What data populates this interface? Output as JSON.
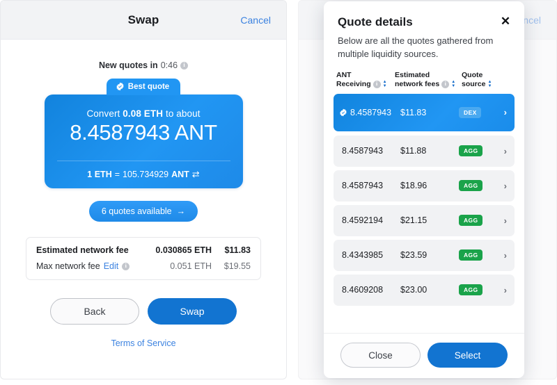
{
  "swap_panel": {
    "header": {
      "title": "Swap",
      "cancel_label": "Cancel"
    },
    "new_quotes": {
      "label": "New quotes in",
      "timer": "0:46",
      "info_icon": "info-icon"
    },
    "best_quote": {
      "tab_label": "Best quote",
      "badge_icon": "verified-check-icon",
      "convert_prefix": "Convert",
      "convert_amount": "0.08 ETH",
      "convert_suffix": "to about",
      "receive_amount": "8.4587943",
      "receive_symbol": "ANT",
      "rate_from": "1 ETH",
      "rate_eq": "=",
      "rate_to_value": "105.734929",
      "rate_to_symbol": "ANT",
      "swap_icon": "swap-arrows-icon"
    },
    "quotes_button": {
      "label": "6 quotes available",
      "arrow_icon": "arrow-right-icon"
    },
    "fees": {
      "estimated_label": "Estimated network fee",
      "estimated_eth": "0.030865 ETH",
      "estimated_usd": "$11.83",
      "max_label": "Max network fee",
      "max_edit_label": "Edit",
      "max_info_icon": "info-icon",
      "max_eth": "0.051 ETH",
      "max_usd": "$19.55"
    },
    "actions": {
      "back_label": "Back",
      "swap_label": "Swap"
    },
    "terms_label": "Terms of Service"
  },
  "background_panel": {
    "header": {
      "title": "Swap",
      "cancel_label": "Cancel"
    }
  },
  "modal": {
    "title": "Quote details",
    "close_icon": "close-icon",
    "subtitle": "Below are all the quotes gathered from multiple liquidity sources.",
    "columns": [
      {
        "line1": "ANT",
        "line2": "Receiving",
        "info_icon": "info-icon",
        "sort_icon": "sort-icon"
      },
      {
        "line1": "Estimated",
        "line2": "network fees",
        "info_icon": "info-icon",
        "sort_icon": "sort-icon"
      },
      {
        "line1": "Quote",
        "line2": "source",
        "info_icon": "",
        "sort_icon": "sort-icon"
      }
    ],
    "rows": [
      {
        "amount": "8.4587943",
        "fee": "$11.83",
        "source": "DEX",
        "source_type": "dex",
        "selected": true,
        "badge_icon": "verified-check-icon",
        "chevron_icon": "chevron-right-icon"
      },
      {
        "amount": "8.4587943",
        "fee": "$11.88",
        "source": "AGG",
        "source_type": "agg",
        "selected": false,
        "badge_icon": "",
        "chevron_icon": "chevron-right-icon"
      },
      {
        "amount": "8.4587943",
        "fee": "$18.96",
        "source": "AGG",
        "source_type": "agg",
        "selected": false,
        "badge_icon": "",
        "chevron_icon": "chevron-right-icon"
      },
      {
        "amount": "8.4592194",
        "fee": "$21.15",
        "source": "AGG",
        "source_type": "agg",
        "selected": false,
        "badge_icon": "",
        "chevron_icon": "chevron-right-icon"
      },
      {
        "amount": "8.4343985",
        "fee": "$23.59",
        "source": "AGG",
        "source_type": "agg",
        "selected": false,
        "badge_icon": "",
        "chevron_icon": "chevron-right-icon"
      },
      {
        "amount": "8.4609208",
        "fee": "$23.00",
        "source": "AGG",
        "source_type": "agg",
        "selected": false,
        "badge_icon": "",
        "chevron_icon": "chevron-right-icon"
      }
    ],
    "footer": {
      "close_label": "Close",
      "select_label": "Select"
    }
  },
  "colors": {
    "accent_blue": "#2196f3",
    "primary_button": "#1274d1",
    "link_blue": "#3b82e0",
    "badge_green": "#1aa34a",
    "badge_dex_blue": "#4aa9f0",
    "header_gray": "#f2f3f5",
    "row_gray": "#f1f2f4"
  }
}
